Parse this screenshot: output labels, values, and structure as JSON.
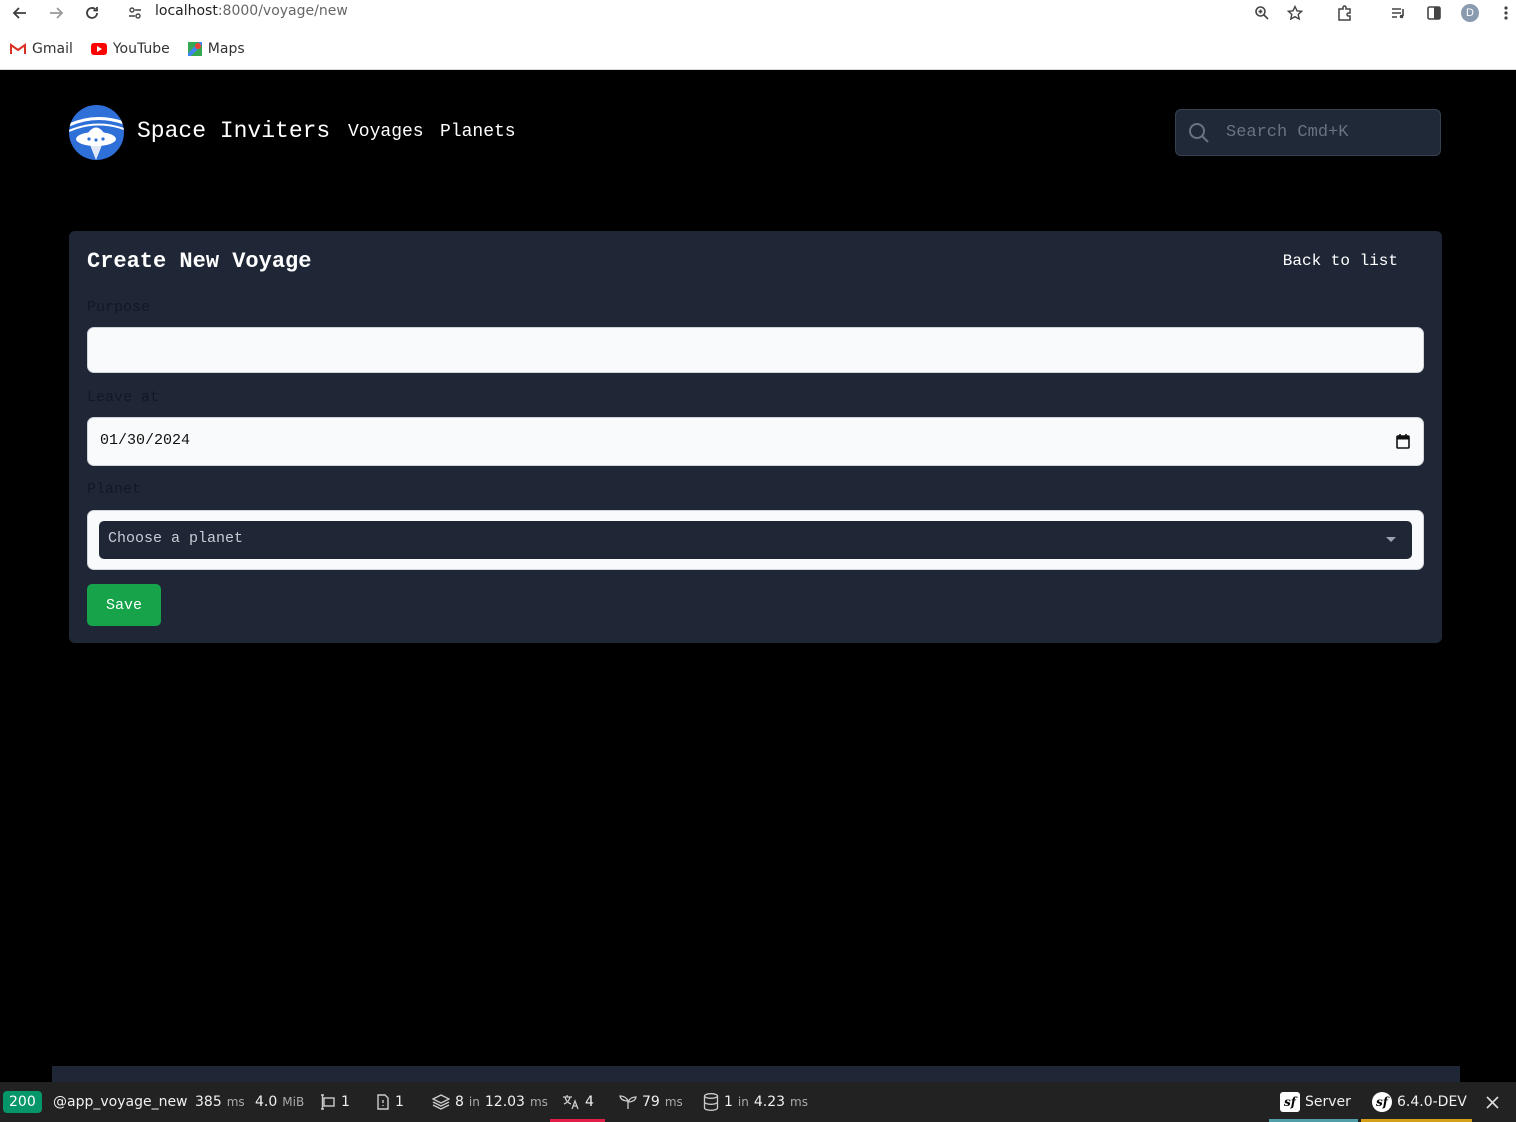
{
  "browser": {
    "url_host": "localhost",
    "url_rest": ":8000/voyage/new",
    "profile_initial": "D",
    "bookmarks": [
      {
        "label": "Gmail",
        "icon": "gmail-icon"
      },
      {
        "label": "YouTube",
        "icon": "youtube-icon"
      },
      {
        "label": "Maps",
        "icon": "maps-icon"
      }
    ]
  },
  "header": {
    "brand": "Space Inviters",
    "nav": [
      "Voyages",
      "Planets"
    ],
    "search_placeholder": "Search Cmd+K"
  },
  "form": {
    "title": "Create New Voyage",
    "back_label": "Back to list",
    "purpose_label": "Purpose",
    "purpose_value": "",
    "leave_label": "Leave at",
    "leave_value": "01/30/2024",
    "planet_label": "Planet",
    "planet_placeholder": "Choose a planet",
    "save_label": "Save"
  },
  "toolbar": {
    "status_code": "200",
    "route": "@app_voyage_new",
    "time_value": "385",
    "time_unit": "ms",
    "memory_value": "4.0",
    "memory_unit": "MiB",
    "forms_count": "1",
    "requests_count": "1",
    "cache_count": "8",
    "cache_in": "in",
    "cache_time": "12.03",
    "cache_unit": "ms",
    "translation_count": "4",
    "twig_time": "79",
    "twig_unit": "ms",
    "db_count": "1",
    "db_in": "in",
    "db_time": "4.23",
    "db_unit": "ms",
    "server_label": "Server",
    "version_label": "6.4.0-DEV"
  },
  "colors": {
    "card_bg": "#1f2737",
    "save_green": "#16a34a",
    "status_green": "#059669"
  }
}
